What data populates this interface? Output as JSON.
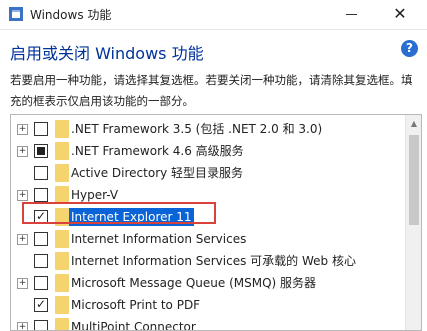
{
  "window": {
    "title": "Windows 功能",
    "close_glyph": "✕"
  },
  "heading": "启用或关闭 Windows 功能",
  "help_glyph": "?",
  "description": "若要启用一种功能，请选择其复选框。若要关闭一种功能，请清除其复选框。填充的框表示仅启用该功能的一部分。",
  "features": [
    {
      "label": ".NET Framework 3.5 (包括 .NET 2.0 和 3.0)",
      "expandable": true,
      "state": "unchecked",
      "selected": false
    },
    {
      "label": ".NET Framework 4.6 高级服务",
      "expandable": true,
      "state": "partial",
      "selected": false
    },
    {
      "label": "Active Directory 轻型目录服务",
      "expandable": false,
      "state": "unchecked",
      "selected": false
    },
    {
      "label": "Hyper-V",
      "expandable": true,
      "state": "unchecked",
      "selected": false
    },
    {
      "label": "Internet Explorer 11",
      "expandable": false,
      "state": "checked",
      "selected": true
    },
    {
      "label": "Internet Information Services",
      "expandable": true,
      "state": "unchecked",
      "selected": false
    },
    {
      "label": "Internet Information Services 可承载的 Web 核心",
      "expandable": false,
      "state": "unchecked",
      "selected": false
    },
    {
      "label": "Microsoft Message Queue (MSMQ) 服务器",
      "expandable": true,
      "state": "unchecked",
      "selected": false
    },
    {
      "label": "Microsoft Print to PDF",
      "expandable": false,
      "state": "checked",
      "selected": false
    },
    {
      "label": "MultiPoint Connector",
      "expandable": true,
      "state": "unchecked",
      "selected": false
    }
  ],
  "glyphs": {
    "expander": "+",
    "check": "✓",
    "scroll_up": "▲"
  },
  "colors": {
    "heading": "#003399",
    "selection": "#0a64d8",
    "highlight_box": "#d9423b",
    "folder": "#f5d36e",
    "help": "#2a6ed1"
  }
}
